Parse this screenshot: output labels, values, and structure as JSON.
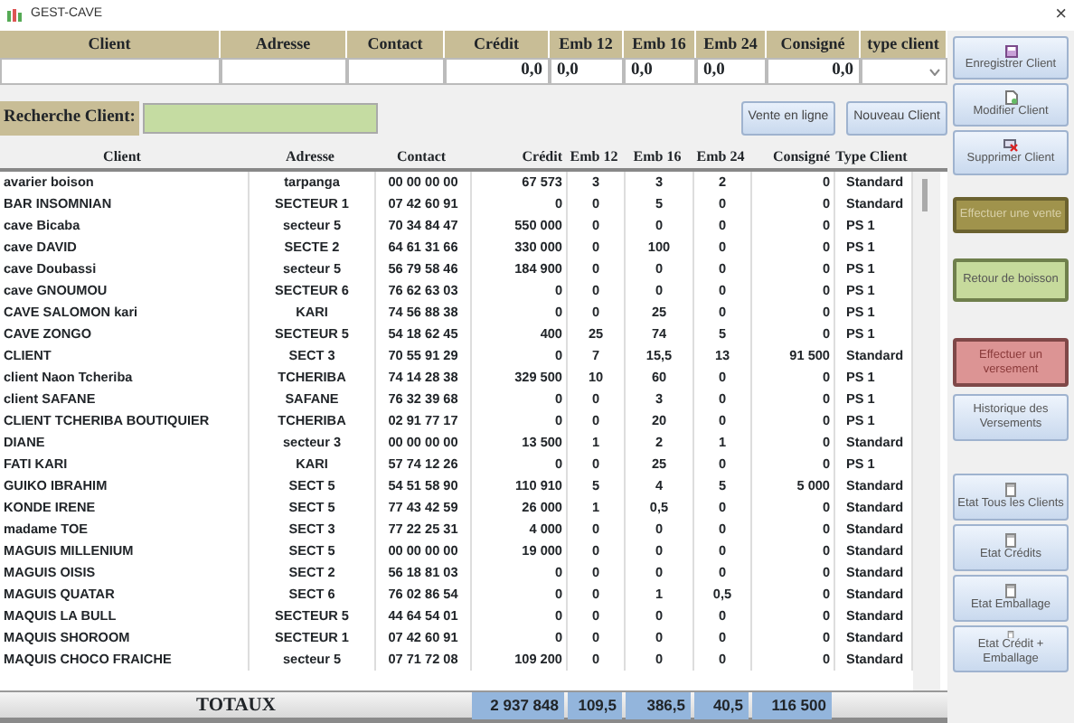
{
  "window": {
    "title": "GEST-CAVE",
    "close": "×"
  },
  "entry_form": {
    "columns": [
      {
        "label": "Client"
      },
      {
        "label": "Adresse"
      },
      {
        "label": "Contact"
      },
      {
        "label": "Crédit",
        "value": "0,0"
      },
      {
        "label": "Emb 12",
        "value": "0,0"
      },
      {
        "label": "Emb 16",
        "value": "0,0"
      },
      {
        "label": "Emb 24",
        "value": "0,0"
      },
      {
        "label": "Consigné",
        "value": "0,0"
      },
      {
        "label": "type client",
        "kind": "select"
      }
    ]
  },
  "search": {
    "label": "Recherche Client:"
  },
  "action_buttons": [
    "Vente en ligne",
    "Nouveau Client"
  ],
  "table": {
    "columns": [
      "Client",
      "Adresse",
      "Contact",
      "Crédit",
      "Emb 12",
      "Emb 16",
      "Emb 24",
      "Consigné",
      "Type Client"
    ],
    "rows": [
      [
        "avarier boison",
        "tarpanga",
        "00 00 00 00",
        "67 573",
        "3",
        "3",
        "2",
        "0",
        "Standard"
      ],
      [
        "BAR INSOMNIAN",
        "SECTEUR 1",
        "07 42 60 91",
        "0",
        "0",
        "5",
        "0",
        "0",
        "Standard"
      ],
      [
        "cave Bicaba",
        "secteur 5",
        "70 34 84 47",
        "550 000",
        "0",
        "0",
        "0",
        "0",
        "PS 1"
      ],
      [
        "cave DAVID",
        "SECTE 2",
        "64 61 31 66",
        "330 000",
        "0",
        "100",
        "0",
        "0",
        "PS 1"
      ],
      [
        "cave Doubassi",
        "secteur 5",
        "56 79 58 46",
        "184 900",
        "0",
        "0",
        "0",
        "0",
        "PS 1"
      ],
      [
        "cave GNOUMOU",
        "SECTEUR 6",
        "76 62 63 03",
        "0",
        "0",
        "0",
        "0",
        "0",
        "PS 1"
      ],
      [
        "CAVE SALOMON kari",
        "KARI",
        "74 56 88 38",
        "0",
        "0",
        "25",
        "0",
        "0",
        "PS 1"
      ],
      [
        "CAVE ZONGO",
        "SECTEUR 5",
        "54 18 62 45",
        "400",
        "25",
        "74",
        "5",
        "0",
        "PS 1"
      ],
      [
        "CLIENT",
        "SECT 3",
        "70 55 91 29",
        "0",
        "7",
        "15,5",
        "13",
        "91 500",
        "Standard"
      ],
      [
        "client Naon Tcheriba",
        "TCHERIBA",
        "74 14 28 38",
        "329 500",
        "10",
        "60",
        "0",
        "0",
        "PS 1"
      ],
      [
        "client SAFANE",
        "SAFANE",
        "76 32 39 68",
        "0",
        "0",
        "3",
        "0",
        "0",
        "PS 1"
      ],
      [
        "CLIENT TCHERIBA BOUTIQUIER",
        "TCHERIBA",
        "02 91 77 17",
        "0",
        "0",
        "20",
        "0",
        "0",
        "PS 1"
      ],
      [
        "DIANE",
        "secteur 3",
        "00 00 00 00",
        "13 500",
        "1",
        "2",
        "1",
        "0",
        "Standard"
      ],
      [
        "FATI  KARI",
        "KARI",
        "57 74 12 26",
        "0",
        "0",
        "25",
        "0",
        "0",
        "PS 1"
      ],
      [
        "GUIKO IBRAHIM",
        "SECT 5",
        "54 51 58 90",
        "110 910",
        "5",
        "4",
        "5",
        "5 000",
        "Standard"
      ],
      [
        "KONDE IRENE",
        "SECT 5",
        "77 43 42 59",
        "26 000",
        "1",
        "0,5",
        "0",
        "0",
        "Standard"
      ],
      [
        "madame TOE",
        "SECT 3",
        "77 22 25 31",
        "4 000",
        "0",
        "0",
        "0",
        "0",
        "Standard"
      ],
      [
        "MAGUIS MILLENIUM",
        "SECT 5",
        "00 00 00 00",
        "19 000",
        "0",
        "0",
        "0",
        "0",
        "Standard"
      ],
      [
        "MAGUIS OISIS",
        "SECT 2",
        "56 18 81 03",
        "0",
        "0",
        "0",
        "0",
        "0",
        "Standard"
      ],
      [
        "MAGUIS QUATAR",
        "SECT 6",
        "76 02 86 54",
        "0",
        "0",
        "1",
        "0,5",
        "0",
        "Standard"
      ],
      [
        "MAQUIS  LA BULL",
        "SECTEUR 5",
        "44 64 54 01",
        "0",
        "0",
        "0",
        "0",
        "0",
        "Standard"
      ],
      [
        "MAQUIS  SHOROOM",
        "SECTEUR 1",
        "07 42 60 91",
        "0",
        "0",
        "0",
        "0",
        "0",
        "Standard"
      ],
      [
        "MAQUIS CHOCO FRAICHE",
        "secteur 5",
        "07 71 72 08",
        "109 200",
        "0",
        "0",
        "0",
        "0",
        "Standard"
      ]
    ]
  },
  "totals": {
    "label": "TOTAUX",
    "values": [
      "2 937 848",
      "109,5",
      "386,5",
      "40,5",
      "116 500"
    ]
  },
  "side_buttons": [
    {
      "label": "Enregistrer Client",
      "kind": "save"
    },
    {
      "label": "Modifier Client",
      "kind": "edit"
    },
    {
      "label": "Supprimer Client",
      "kind": "delete"
    },
    {
      "label": "Effectuer une vente",
      "kind": "sale"
    },
    {
      "label": "Retour de boisson",
      "kind": "return"
    },
    {
      "label": "Effectuer un versement",
      "kind": "payment"
    },
    {
      "label": "Historique des Versements",
      "kind": "history"
    },
    {
      "label": "Etat Tous les Clients",
      "kind": "report"
    },
    {
      "label": "Etat Crédits",
      "kind": "report"
    },
    {
      "label": "Etat Emballage",
      "kind": "report"
    },
    {
      "label": "Etat Crédit + Emballage",
      "kind": "report"
    }
  ]
}
